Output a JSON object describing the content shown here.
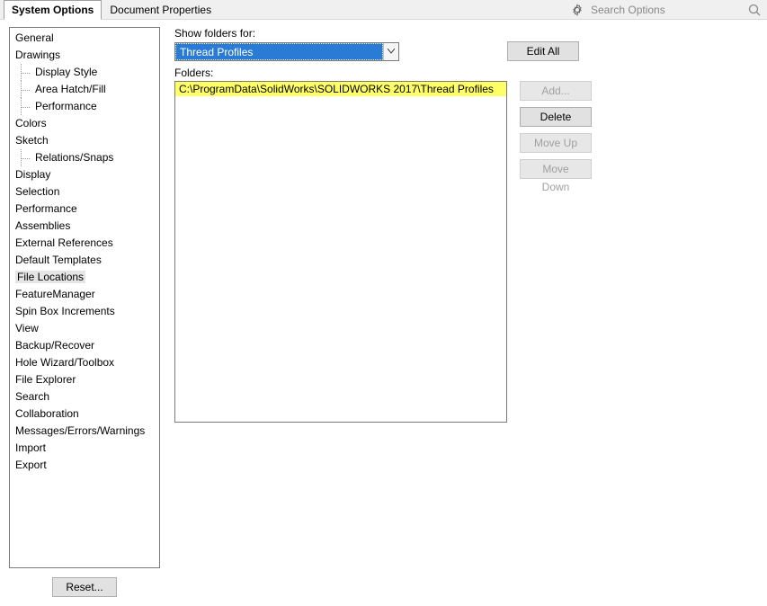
{
  "tabs": {
    "system_options": "System Options",
    "document_properties": "Document Properties"
  },
  "search": {
    "placeholder": "Search Options"
  },
  "tree": {
    "items": [
      {
        "label": "General",
        "indent": 0
      },
      {
        "label": "Drawings",
        "indent": 0
      },
      {
        "label": "Display Style",
        "indent": 1
      },
      {
        "label": "Area Hatch/Fill",
        "indent": 1
      },
      {
        "label": "Performance",
        "indent": 1
      },
      {
        "label": "Colors",
        "indent": 0
      },
      {
        "label": "Sketch",
        "indent": 0
      },
      {
        "label": "Relations/Snaps",
        "indent": 1
      },
      {
        "label": "Display",
        "indent": 0
      },
      {
        "label": "Selection",
        "indent": 0
      },
      {
        "label": "Performance",
        "indent": 0
      },
      {
        "label": "Assemblies",
        "indent": 0
      },
      {
        "label": "External References",
        "indent": 0
      },
      {
        "label": "Default Templates",
        "indent": 0
      },
      {
        "label": "File Locations",
        "indent": 0,
        "selected": true
      },
      {
        "label": "FeatureManager",
        "indent": 0
      },
      {
        "label": "Spin Box Increments",
        "indent": 0
      },
      {
        "label": "View",
        "indent": 0
      },
      {
        "label": "Backup/Recover",
        "indent": 0
      },
      {
        "label": "Hole Wizard/Toolbox",
        "indent": 0
      },
      {
        "label": "File Explorer",
        "indent": 0
      },
      {
        "label": "Search",
        "indent": 0
      },
      {
        "label": "Collaboration",
        "indent": 0
      },
      {
        "label": "Messages/Errors/Warnings",
        "indent": 0
      },
      {
        "label": "Import",
        "indent": 0
      },
      {
        "label": "Export",
        "indent": 0
      }
    ]
  },
  "reset_label": "Reset...",
  "main": {
    "show_folders_label": "Show folders for:",
    "dropdown_value": "Thread Profiles",
    "edit_all_label": "Edit All",
    "folders_label": "Folders:",
    "folder_items": [
      "C:\\ProgramData\\SolidWorks\\SOLIDWORKS 2017\\Thread Profiles"
    ],
    "buttons": {
      "add": "Add...",
      "delete": "Delete",
      "move_up": "Move Up",
      "move_down": "Move Down"
    }
  }
}
